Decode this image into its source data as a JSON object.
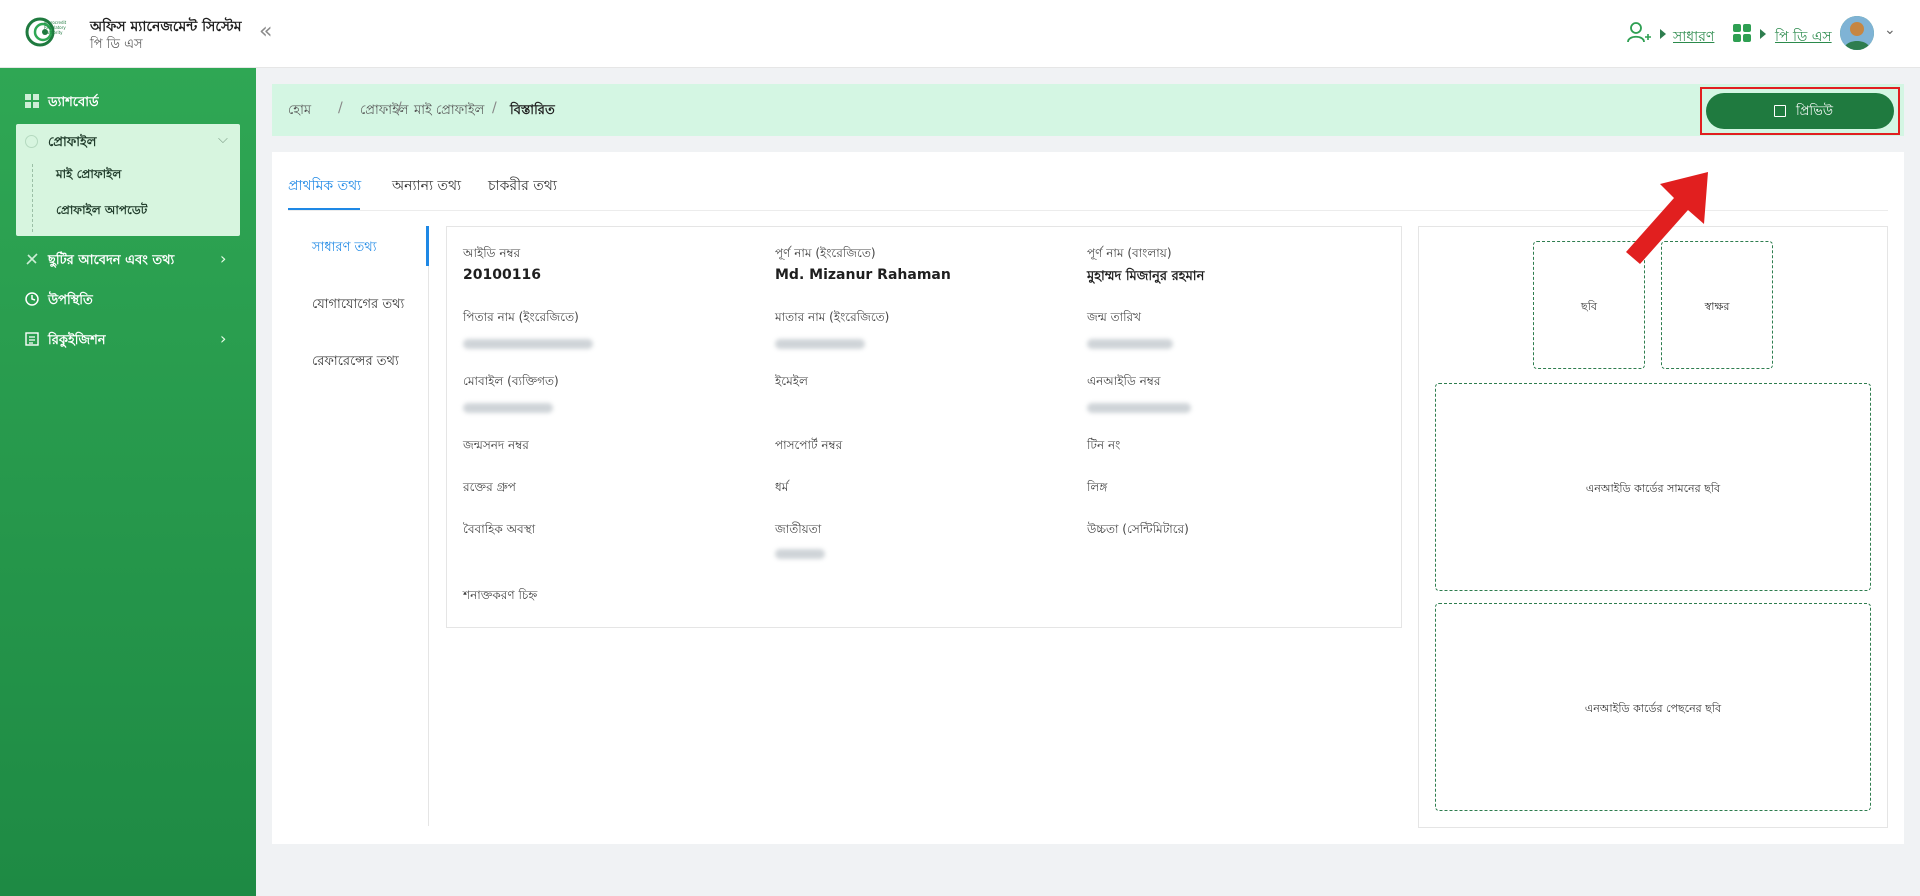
{
  "header": {
    "brand_title": "অফিস ম্যানেজমেন্ট সিস্টেম",
    "brand_sub": "পি ডি এস",
    "logo_text": "Microcredit Regulatory Authority",
    "role_link": "সাধারণ",
    "module_link": "পি ডি এস"
  },
  "sidebar": {
    "dashboard": "ড্যাশবোর্ড",
    "profile": "প্রোফাইল",
    "my_profile": "মাই প্রোফাইল",
    "profile_update": "প্রোফাইল আপডেট",
    "leave": "ছুটির আবেদন এবং তথ্য",
    "attendance": "উপস্থিতি",
    "requisition": "রিকুইজিশন"
  },
  "breadcrumb": [
    "হোম",
    "প্রোফাইল",
    "মাই প্রোফাইল",
    "বিস্তারিত"
  ],
  "preview_button": "প্রিভিউ",
  "tabs": [
    "প্রাথমিক তথ্য",
    "অন্যান্য তথ্য",
    "চাকরীর তথ্য"
  ],
  "side_nav": [
    "সাধারণ তথ্য",
    "যোগাযোগের তথ্য",
    "রেফারেন্সের তথ্য"
  ],
  "fields": {
    "id_label": "আইডি নম্বর",
    "id_value": "20100116",
    "name_en_label": "পূর্ণ নাম (ইংরেজিতে)",
    "name_en_value": "Md. Mizanur Rahaman",
    "name_bn_label": "পূর্ণ নাম (বাংলায়)",
    "name_bn_value": "মুহাম্মদ মিজানুর রহমান",
    "father_label": "পিতার নাম (ইংরেজিতে)",
    "mother_label": "মাতার নাম (ইংরেজিতে)",
    "dob_label": "জন্ম তারিখ",
    "mobile_label": "মোবাইল (ব্যক্তিগত)",
    "email_label": "ইমেইল",
    "nid_label": "এনআইডি নম্বর",
    "birthcert_label": "জন্মসনদ নম্বর",
    "passport_label": "পাসপোর্ট নম্বর",
    "tin_label": "টিন নং",
    "blood_label": "রক্তের গ্রুপ",
    "religion_label": "ধর্ম",
    "gender_label": "লিঙ্গ",
    "marital_label": "বৈবাহিক অবস্থা",
    "nationality_label": "জাতীয়তা",
    "height_label": "উচ্চতা (সেন্টিমিটারে)",
    "mark_label": "শনাক্তকরণ চিহ্ন"
  },
  "images": {
    "photo": "ছবি",
    "signature": "স্বাক্ষর",
    "nid_front": "এনআইডি কার্ডের সামনের ছবি",
    "nid_back": "এনআইডি কার্ডের পেছনের ছবি"
  },
  "colors": {
    "primary": "#1f7a3f",
    "sidebar": "#2fa754",
    "accent": "#1e88e5",
    "breadcrumb_bg": "#d4f6e3",
    "annotation": "#e11f1f"
  }
}
